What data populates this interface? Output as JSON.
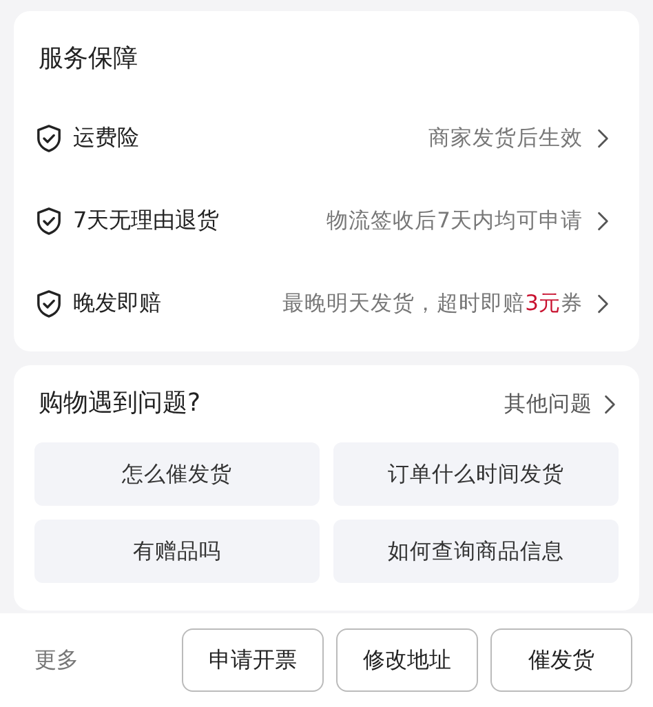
{
  "service_card": {
    "title": "服务保障",
    "items": [
      {
        "name": "运费险",
        "detail": [
          {
            "text": "商家发货后生效",
            "highlight": false
          }
        ]
      },
      {
        "name": "7天无理由退货",
        "detail": [
          {
            "text": "物流签收后7天内均可申请",
            "highlight": false
          }
        ]
      },
      {
        "name": "晚发即赔",
        "detail": [
          {
            "text": "最晚明天发货，超时即赔",
            "highlight": false
          },
          {
            "text": "3元",
            "highlight": true
          },
          {
            "text": "券",
            "highlight": false
          }
        ]
      }
    ]
  },
  "questions_card": {
    "title": "购物遇到问题?",
    "more_link": "其他问题",
    "questions": [
      "怎么催发货",
      "订单什么时间发货",
      "有赠品吗",
      "如何查询商品信息"
    ]
  },
  "bottom_bar": {
    "more": "更多",
    "buttons": [
      "申请开票",
      "修改地址",
      "催发货"
    ]
  }
}
